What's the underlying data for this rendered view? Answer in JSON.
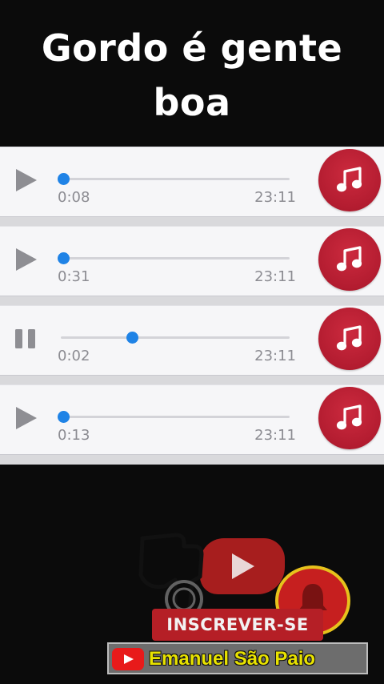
{
  "title_line1": "Gordo é gente",
  "title_line2": "boa",
  "audio_messages": [
    {
      "state": "play",
      "current_time": "0:08",
      "end_time": "23:11",
      "progress": 0.0,
      "icon": "music-note-icon"
    },
    {
      "state": "play",
      "current_time": "0:31",
      "end_time": "23:11",
      "progress": 0.0,
      "icon": "music-note-icon"
    },
    {
      "state": "pause",
      "current_time": "0:02",
      "end_time": "23:11",
      "progress": 0.31,
      "icon": "music-note-icon"
    },
    {
      "state": "play",
      "current_time": "0:13",
      "end_time": "23:11",
      "progress": 0.0,
      "icon": "music-note-icon"
    }
  ],
  "subscribe": {
    "button_label": "INSCREVER-SE",
    "channel_name": "Emanuel São Paio"
  },
  "colors": {
    "badge_red": "#b31c30",
    "progress_blue": "#1f83e6",
    "subscribe_red": "#b51f26",
    "channel_yellow": "#e8e200"
  }
}
